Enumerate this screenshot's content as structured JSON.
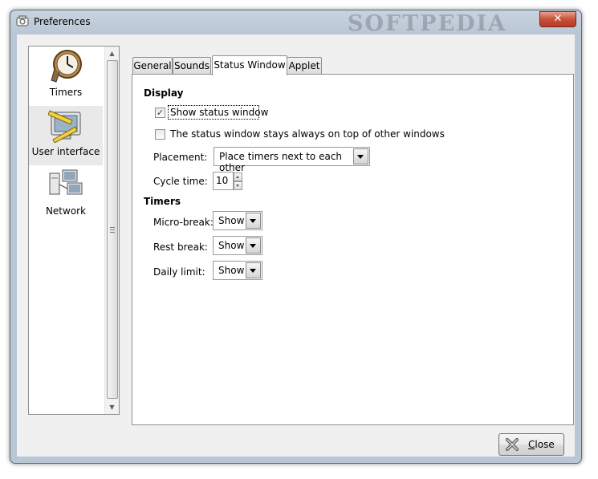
{
  "window": {
    "title": "Preferences",
    "watermark": "SOFTPEDIA",
    "close_glyph": "✕"
  },
  "sidebar": {
    "items": [
      {
        "label": "Timers",
        "icon": "clock-icon",
        "selected": false
      },
      {
        "label": "User interface",
        "icon": "monitor-ruler-icon",
        "selected": true
      },
      {
        "label": "Network",
        "icon": "network-computers-icon",
        "selected": false
      }
    ]
  },
  "tabs": [
    {
      "label": "General",
      "active": false
    },
    {
      "label": "Sounds",
      "active": false
    },
    {
      "label": "Status Window",
      "active": true
    },
    {
      "label": "Applet",
      "active": false
    }
  ],
  "display": {
    "heading": "Display",
    "show_status_window": {
      "label": "Show status window",
      "checked": true
    },
    "always_on_top": {
      "label": "The status window stays always on top of other windows",
      "checked": false
    },
    "placement": {
      "label": "Placement:",
      "value": "Place timers next to each other"
    },
    "cycle_time": {
      "label": "Cycle time:",
      "value": "10"
    }
  },
  "timers": {
    "heading": "Timers",
    "micro_break": {
      "label": "Micro-break:",
      "value": "Show"
    },
    "rest_break": {
      "label": "Rest break:",
      "value": "Show"
    },
    "daily_limit": {
      "label": "Daily limit:",
      "value": "Show"
    }
  },
  "footer": {
    "close_label": "Close"
  },
  "colors": {
    "accent": "#1c3d7a",
    "window_frame": "#b9c6d4",
    "close_red": "#c9503a"
  }
}
